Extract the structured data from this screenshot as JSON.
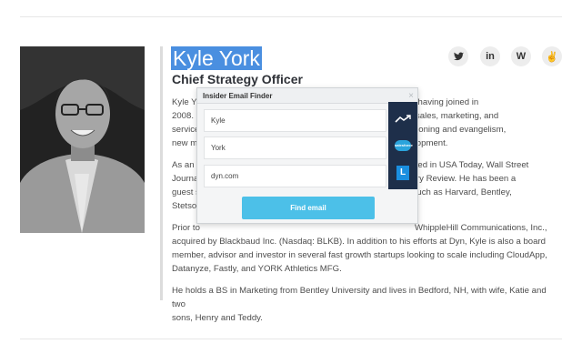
{
  "profile": {
    "name": "Kyle York",
    "title": "Chief Strategy Officer"
  },
  "social": [
    {
      "icon": "twitter-icon",
      "glyph": "t"
    },
    {
      "icon": "linkedin-icon",
      "glyph": "in"
    },
    {
      "icon": "wordpress-icon",
      "glyph": "W"
    },
    {
      "icon": "angellist-icon",
      "glyph": "✌"
    }
  ],
  "bio": {
    "p1": [
      "Kyle Yo",
      "ng-time executive, having joined in",
      "2008. C",
      "orldwide sales, marketing, and",
      "service",
      "ding: positioning and evangelism,",
      "new m",
      "ess development."
    ],
    "p2": [
      "As an e",
      "en featured in USA Today, Wall Street",
      "Journa",
      "ing Industry Review. He has been a",
      "guest s",
      "obally, such as Harvard, Bentley,",
      "Stetsor"
    ],
    "p3": {
      "line1_left": "Prior to",
      "line1_right": "WhippleHill Communications, Inc.,",
      "line2": "acquired by Blackbaud Inc. (Nasdaq: BLKB). In addition to his efforts at Dyn, Kyle is also a board",
      "line3": "member, advisor and investor in several fast growth startups looking to scale including CloudApp,",
      "line4": "Datanyze, Fastly, and YORK Athletics MFG."
    },
    "p4": {
      "line1": "He holds a BS in Marketing from Bentley University and lives in Bedford, NH, with wife, Katie and two",
      "line2": "sons, Henry and Teddy."
    }
  },
  "popup": {
    "title": "Insider Email Finder",
    "close": "×",
    "first_name": "Kyle",
    "last_name": "York",
    "domain": "dyn.com",
    "button": "Find email",
    "side_icons": [
      "trend-icon",
      "salesforce-icon",
      "lever-icon"
    ],
    "salesforce_text": "salesforce",
    "lever_text": "L"
  },
  "colors": {
    "highlight": "#4a8fe0",
    "button": "#4cc0e8",
    "side_panel": "#1e2f4a"
  }
}
